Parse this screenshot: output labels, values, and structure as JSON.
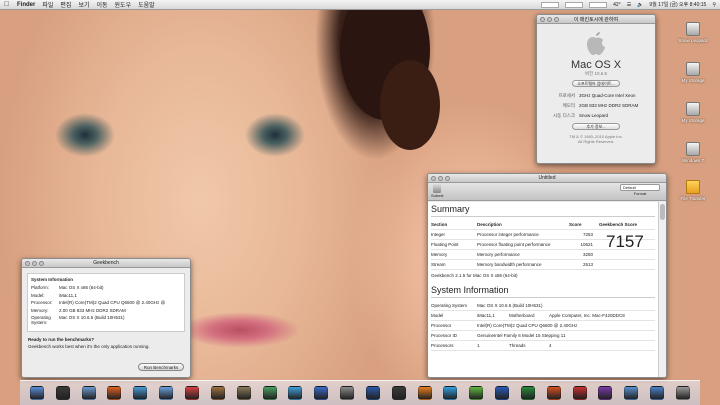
{
  "menubar": {
    "app": "Finder",
    "items": [
      "파일",
      "편집",
      "보기",
      "이동",
      "윈도우",
      "도움말"
    ],
    "clock": "9월 17일 (금) 오후 8:40:15",
    "temp": "42°"
  },
  "about": {
    "title": "이 매킨토시에 관하여",
    "os_name": "Mac OS X",
    "version": "버전 10.6.5",
    "update_button": "소프트웨어 업데이트...",
    "processor_label": "프로세서",
    "processor_value": "3GHz Quad-Core Intel Xeon",
    "memory_label": "메모리",
    "memory_value": "2GB 833 MHz DDR2 SDRAM",
    "startup_label": "시동 디스크",
    "startup_value": "Snow Leopard",
    "more_button": "추가 정보...",
    "copyright1": "TM & © 1983–2010 Apple Inc.",
    "copyright2": "All Rights Reserved."
  },
  "desktop_icons": [
    {
      "label": "Snow Leopard",
      "type": "drive"
    },
    {
      "label": "My Storage",
      "type": "drive"
    },
    {
      "label": "My Storage",
      "type": "drive"
    },
    {
      "label": "Windows 7",
      "type": "drive"
    },
    {
      "label": "File Transfer",
      "type": "folder"
    }
  ],
  "results": {
    "title": "Untitled",
    "submit_label": "Submit",
    "format_label": "Format",
    "format_value": "Default",
    "summary_heading": "Summary",
    "col_section": "Section",
    "col_description": "Description",
    "col_score": "Score",
    "col_gb_score": "Geekbench Score",
    "rows": [
      {
        "section": "Integer",
        "description": "Processor integer performance",
        "score": "7253"
      },
      {
        "section": "Floating Point",
        "description": "Processor floating point performance",
        "score": "10621"
      },
      {
        "section": "Memory",
        "description": "Memory performance",
        "score": "3250"
      },
      {
        "section": "Stream",
        "description": "Memory bandwidth performance",
        "score": "2513"
      }
    ],
    "geekbench_score": "7157",
    "footer_note": "Geekbench 2.1.5 for Mac OS X x86 (64-bit)",
    "sysinfo_heading": "System Information",
    "sys_rows": [
      {
        "k": "Operating System",
        "v": "Mac OS X 10.6.5 (Build 10H531)",
        "k2": "",
        "v2": ""
      },
      {
        "k": "Model",
        "v": "iMac11,1",
        "k2": "Motherboard",
        "v2": "Apple Computer, Inc. Mac-F420DDC8"
      },
      {
        "k": "Processor",
        "v": "Intel(R) Core(TM)2 Quad CPU Q6600 @ 2.40GHz",
        "k2": "",
        "v2": ""
      },
      {
        "k": "Processor ID",
        "v": "GenuineIntel Family 6 Model 15 Stepping 11",
        "k2": "",
        "v2": ""
      },
      {
        "k": "Processors",
        "v": "1",
        "k2": "Threads",
        "v2": "4"
      }
    ]
  },
  "geekbench": {
    "title": "Geekbench",
    "heading": "System Information",
    "info": [
      {
        "k": "Platform:",
        "v": "Mac OS X x86 (64-bit)"
      },
      {
        "k": "Model:",
        "v": "iMac11,1"
      },
      {
        "k": "Processor:",
        "v": "Intel(R) Core(TM)2 Quad CPU   Q6600 @ 2.40GHz @"
      },
      {
        "k": "Memory:",
        "v": "2.00 GB 833 MHz DDR2 SDRAM"
      },
      {
        "k": "Operating System:",
        "v": "Mac OS X 10.6.5 (Build 10H531)"
      }
    ],
    "ready_heading": "Ready to run the benchmarks?",
    "ready_text": "Geekbench works best when it's the only application running.",
    "run_button": "Run Benchmarks"
  },
  "dock": {
    "icons": [
      "finder-icon",
      "dashboard-icon",
      "mail-icon",
      "firefox-icon",
      "safari-icon",
      "itunes-icon",
      "ical-icon",
      "address-book-icon",
      "photo-icon",
      "preview-icon",
      "iphoto-icon",
      "app-store-icon",
      "system-prefs-icon",
      "xcode-icon",
      "terminal-icon",
      "vlc-icon",
      "skype-icon",
      "adium-icon",
      "word-icon",
      "excel-icon",
      "powerpoint-icon",
      "parallels-icon",
      "geekbench-icon",
      "folder-icon",
      "downloads-icon",
      "trash-icon"
    ],
    "colors": [
      "#5a8ed8",
      "#3a3a3a",
      "#6a9ad0",
      "#e06020",
      "#4a9ad8",
      "#6aa0e0",
      "#d84040",
      "#a07040",
      "#8a7a5a",
      "#4aa060",
      "#40a0d8",
      "#3a6ac8",
      "#8a8a8a",
      "#2a5aa8",
      "#3a3a3a",
      "#e88020",
      "#30a0e0",
      "#60b840",
      "#2a5ab8",
      "#2a8a3a",
      "#d85020",
      "#c83030",
      "#7a3aa8",
      "#5a90d0",
      "#4a80c8",
      "#9a9a9a"
    ]
  }
}
